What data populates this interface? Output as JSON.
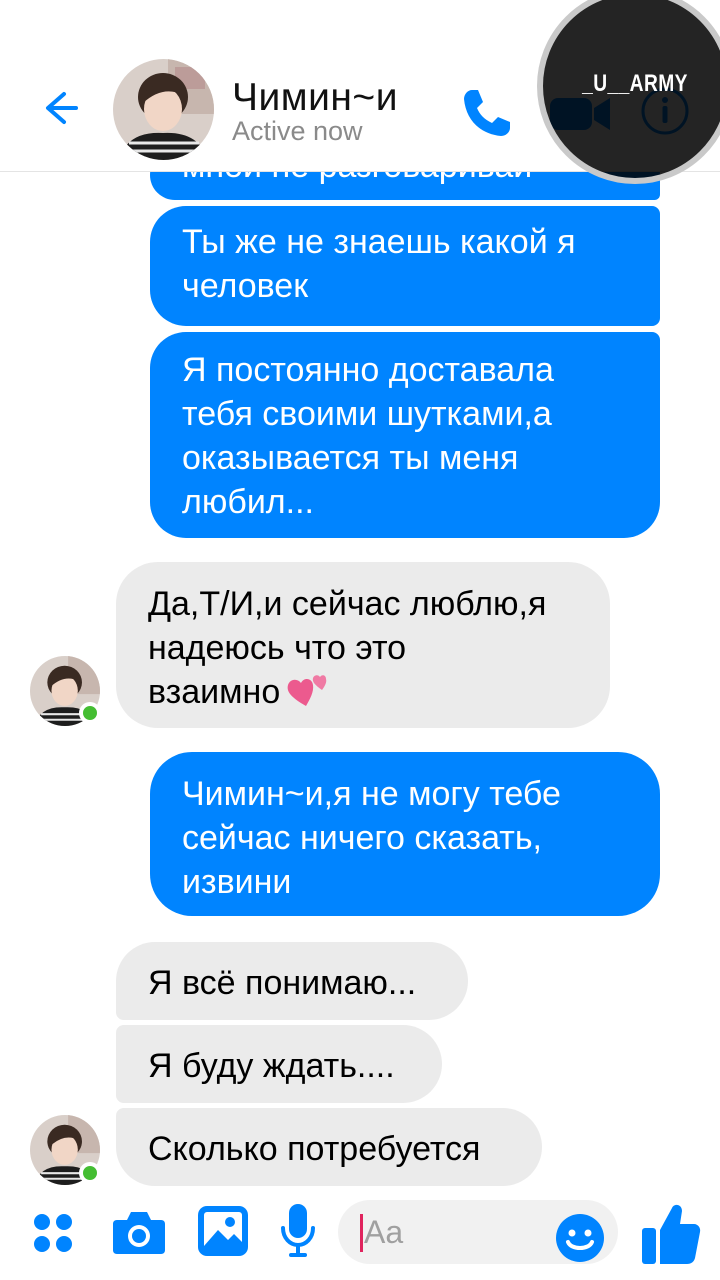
{
  "header": {
    "contact_name": "Чимин~и",
    "status": "Active now"
  },
  "watermark": {
    "text": "_U__ARMY"
  },
  "messages": [
    {
      "from": "me",
      "lines": [
        "мной не разговаривай"
      ]
    },
    {
      "from": "me",
      "lines": [
        "Ты же не знаешь какой я",
        "человек"
      ]
    },
    {
      "from": "me",
      "lines": [
        "Я постоянно доставала",
        "тебя своими шутками,а",
        "оказывается ты меня",
        "любил..."
      ]
    },
    {
      "from": "them",
      "lines": [
        "Да,Т/И,и сейчас люблю,я",
        "надеюсь что это",
        "взаимно"
      ],
      "emoji": "two-hearts"
    },
    {
      "from": "me",
      "lines": [
        "Чимин~и,я не могу тебе",
        "сейчас ничего сказать,",
        "извини"
      ]
    },
    {
      "from": "them",
      "lines": [
        "Я всё понимаю..."
      ]
    },
    {
      "from": "them",
      "lines": [
        "Я буду ждать...."
      ]
    },
    {
      "from": "them",
      "lines": [
        "Сколько потребуется"
      ]
    }
  ],
  "composer": {
    "placeholder": "Aa",
    "icons": [
      "apps-icon",
      "camera-icon",
      "gallery-icon",
      "microphone-icon",
      "emoji-icon",
      "thumbs-up-icon"
    ]
  },
  "colors": {
    "accent": "#0084ff",
    "incoming_bubble": "#ebebeb",
    "online": "#44bd32"
  }
}
